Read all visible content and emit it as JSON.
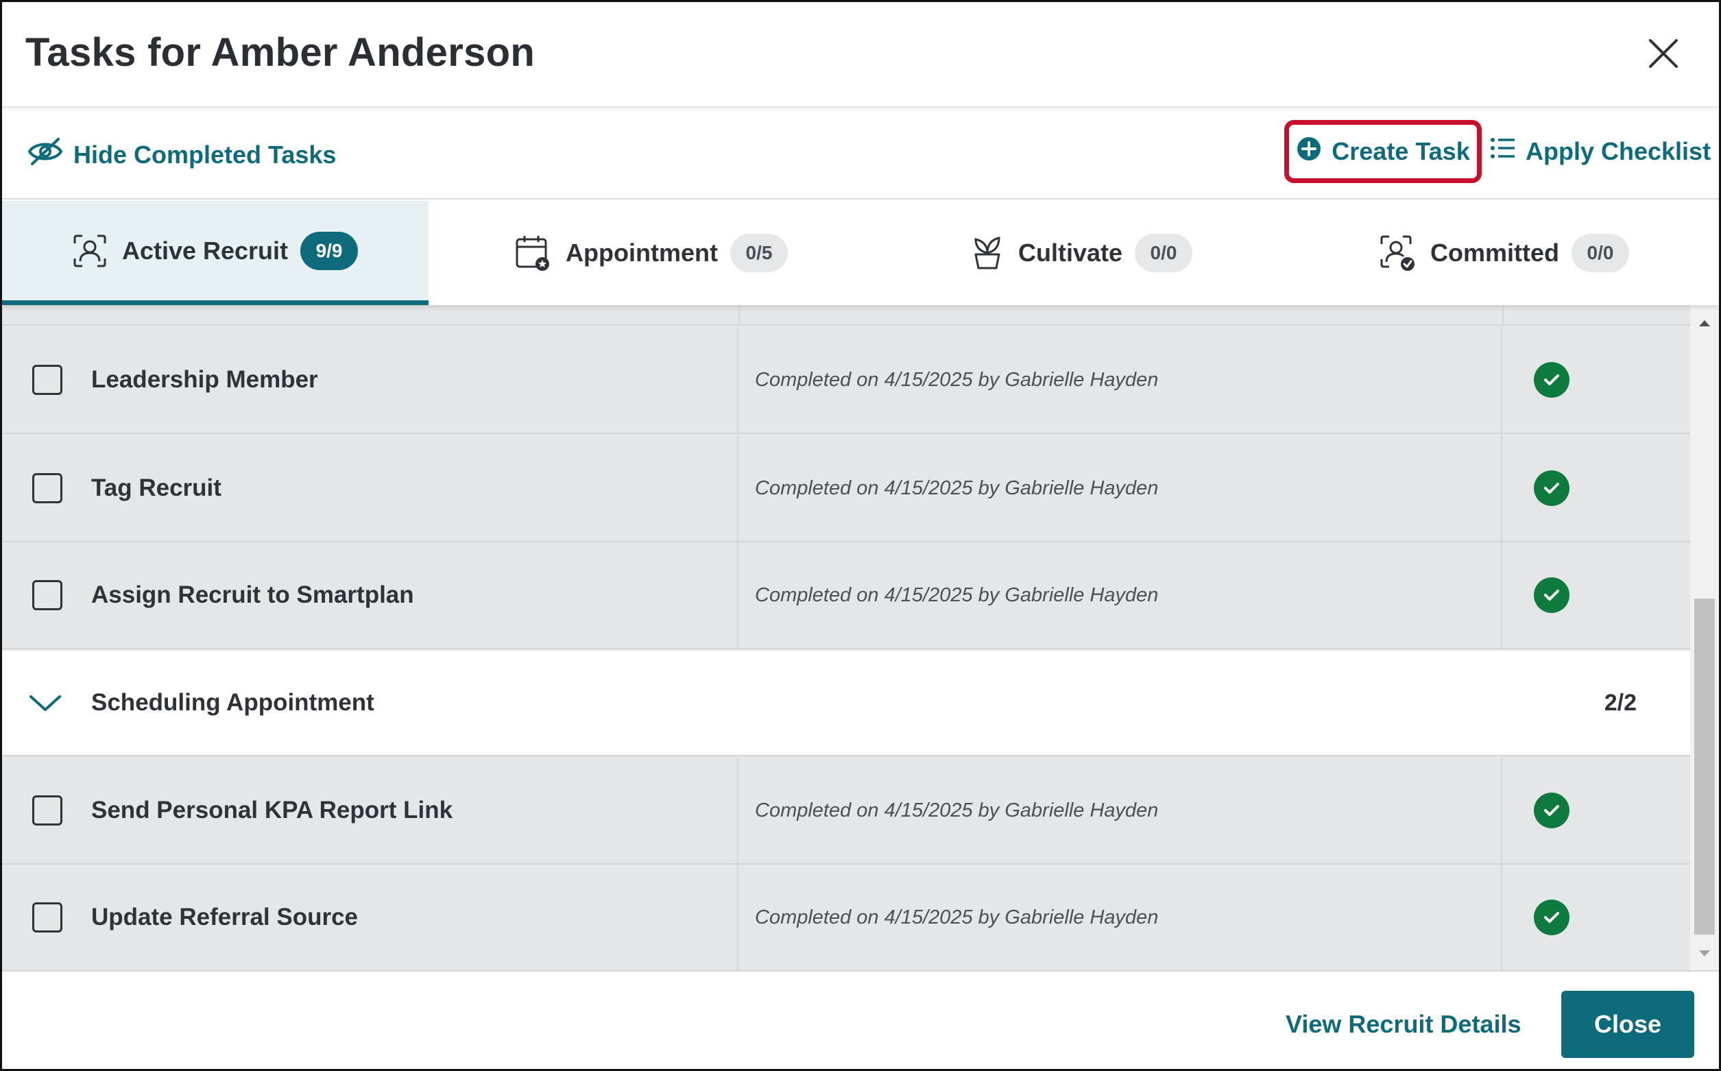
{
  "dialog": {
    "title": "Tasks for Amber Anderson"
  },
  "toolbar": {
    "hide_completed_label": "Hide Completed Tasks",
    "create_task_label": "Create Task",
    "apply_checklist_label": "Apply Checklist",
    "accent_color": "#0d6b7c",
    "highlight_color": "#c8102e"
  },
  "tabs": [
    {
      "label": "Active Recruit",
      "count": "9/9",
      "icon": "person-scan-icon",
      "active": true
    },
    {
      "label": "Appointment",
      "count": "0/5",
      "icon": "calendar-star-icon",
      "active": false
    },
    {
      "label": "Cultivate",
      "count": "0/0",
      "icon": "plant-pot-icon",
      "active": false
    },
    {
      "label": "Committed",
      "count": "0/0",
      "icon": "person-check-icon",
      "active": false
    }
  ],
  "tasks_before_group": [
    {
      "name": "Leadership Member",
      "status": "Completed on 4/15/2025 by Gabrielle Hayden",
      "done": true
    },
    {
      "name": "Tag Recruit",
      "status": "Completed on 4/15/2025 by Gabrielle Hayden",
      "done": true
    },
    {
      "name": "Assign Recruit to Smartplan",
      "status": "Completed on 4/15/2025 by Gabrielle Hayden",
      "done": true
    }
  ],
  "group": {
    "title": "Scheduling Appointment",
    "count": "2/2"
  },
  "tasks_after_group": [
    {
      "name": "Send Personal KPA Report Link",
      "status": "Completed on 4/15/2025 by Gabrielle Hayden",
      "done": true
    },
    {
      "name": "Update Referral Source",
      "status": "Completed on 4/15/2025 by Gabrielle Hayden",
      "done": true
    }
  ],
  "footer": {
    "view_details_label": "View Recruit Details",
    "close_label": "Close"
  }
}
